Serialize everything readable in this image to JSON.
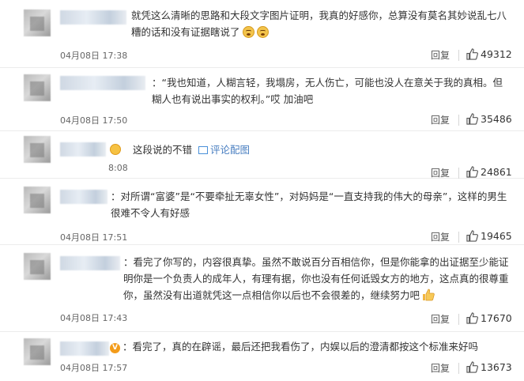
{
  "comments": [
    {
      "text": "就凭这么清晰的思路和大段文字图片证明，我真的好感你，总算没有莫名其妙说乱七八糟的话和没有证据瞎说了",
      "date": "04月08日 17:38",
      "reply": "回复",
      "likes": "49312",
      "emoji_count": 2
    },
    {
      "text": "：“我也知道，人糊言轻，我塌房，无人伤亡，可能也没人在意关于我的真相。但糊人也有说出事实的权利。”哎 加油吧",
      "date": "04月08日 17:50",
      "reply": "回复",
      "likes": "35486"
    },
    {
      "text": "这段说的不错",
      "link_label": "评论配图",
      "date": "8:08",
      "reply": "回复",
      "likes": "24861"
    },
    {
      "text": "：对所谓“富婆”是“不要牵扯无辜女性”，对妈妈是“一直支持我的伟大的母亲”，这样的男生很难不令人有好感",
      "date": "04月08日 17:51",
      "reply": "回复",
      "likes": "19465"
    },
    {
      "text": "：看完了你写的，内容很真挚。虽然不敢说百分百相信你，但是你能拿的出证据至少能证明你是一个负责人的成年人，有理有据，你也没有任何诋毁女方的地方，这点真的很尊重你，虽然没有出道就凭这一点相信你以后也不会很差的，继续努力吧",
      "date": "04月08日 17:43",
      "reply": "回复",
      "likes": "17670"
    },
    {
      "text": "：看完了，真的在辟谣，最后还把我看伤了，内娱以后的澄清都按这个标准来好吗",
      "date": "04月08日 17:57",
      "reply": "回复",
      "likes": "13673"
    }
  ],
  "icons": {
    "like": "thumbs-up-icon",
    "emoji": "crying-emoji-icon",
    "picture": "picture-icon"
  },
  "colors": {
    "link": "#eb7350",
    "text": "#333333",
    "meta": "#666666"
  }
}
